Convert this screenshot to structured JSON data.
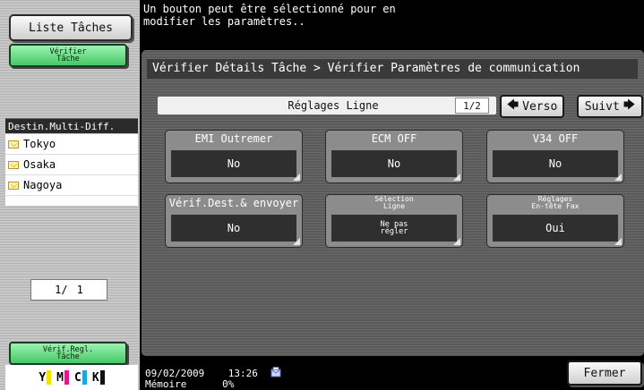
{
  "sidebar": {
    "job_list_button": "Liste Tâches",
    "check_job_button": [
      "Vérifier",
      "Tâche"
    ],
    "destinations_header": "Destin.Multi-Diff.",
    "destinations": [
      "Tokyo",
      "Osaka",
      "Nagoya"
    ],
    "page_current": "1/",
    "page_total": "1",
    "check_settings_button": [
      "Vérif.Regl.",
      "Tâche"
    ],
    "toner_labels": [
      "Y",
      "M",
      "C",
      "K"
    ]
  },
  "message": "Un bouton peut être sélectionné pour en\nmodifier les paramètres..",
  "breadcrumb": "Vérifier Détails Tâche > Vérifier Paramètres de communication",
  "section": {
    "title": "Réglages Ligne",
    "page": "1/2",
    "prev_label": "Verso",
    "next_label": "Suivt"
  },
  "settings": [
    {
      "label": "EMI Outremer",
      "value": "No"
    },
    {
      "label": "ECM OFF",
      "value": "No"
    },
    {
      "label": "V34 OFF",
      "value": "No"
    },
    {
      "label": "Vérif.Dest.& envoyer",
      "value": "No"
    },
    {
      "label": [
        "Sélection",
        "Ligne"
      ],
      "value": [
        "Ne pas",
        "régler"
      ]
    },
    {
      "label": [
        "Réglages",
        "En-tête Fax"
      ],
      "value": "Oui"
    }
  ],
  "status": {
    "date": "09/02/2009",
    "time": "13:26",
    "memory_label": "Mémoire",
    "memory_value": "0%"
  },
  "close_button": "Fermer",
  "colors": {
    "green_button": "#46c766",
    "toner_yellow": "#f2e200",
    "toner_magenta": "#e0188c",
    "toner_cyan": "#1aa7e0",
    "toner_black": "#111111"
  }
}
